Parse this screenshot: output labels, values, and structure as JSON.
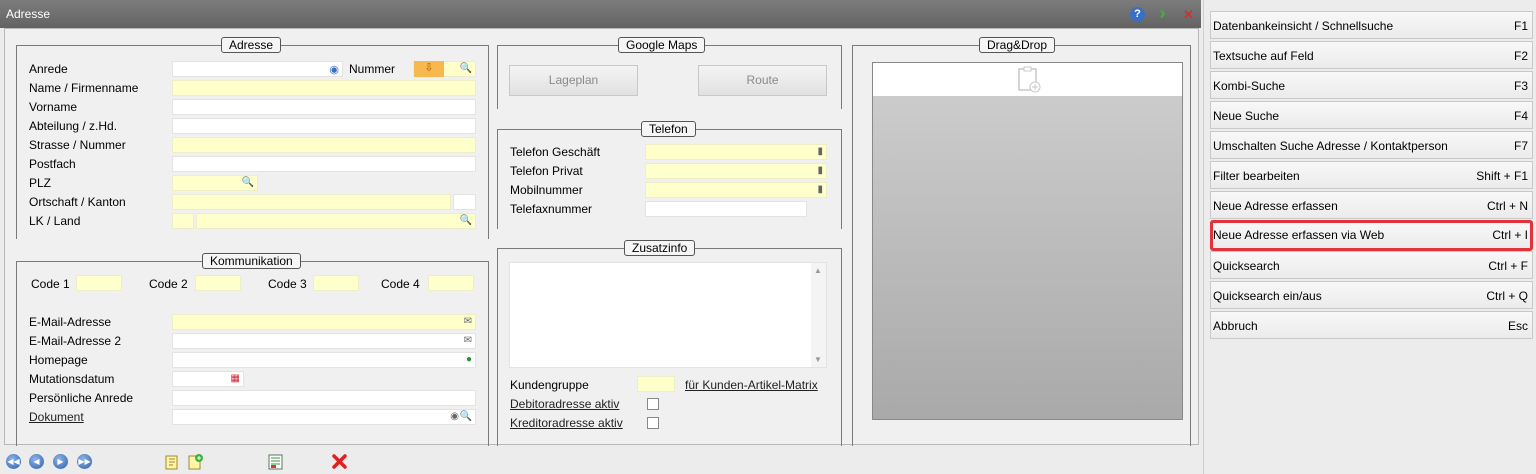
{
  "window": {
    "title": "Adresse",
    "help": "?",
    "next": "›",
    "close": "✕"
  },
  "adresse": {
    "legend": "Adresse",
    "anrede": "Anrede",
    "nummer": "Nummer",
    "name": "Name / Firmenname",
    "vorname": "Vorname",
    "abteilung": "Abteilung / z.Hd.",
    "strasse": "Strasse / Nummer",
    "postfach": "Postfach",
    "plz": "PLZ",
    "ortschaft": "Ortschaft / Kanton",
    "lk": "LK / Land"
  },
  "google": {
    "legend": "Google Maps",
    "lageplan": "Lageplan",
    "route": "Route"
  },
  "telefon": {
    "legend": "Telefon",
    "geschaeft": "Telefon Geschäft",
    "privat": "Telefon Privat",
    "mobil": "Mobilnummer",
    "fax": "Telefaxnummer"
  },
  "dragdrop": {
    "legend": "Drag&Drop"
  },
  "kommunikation": {
    "legend": "Kommunikation",
    "code1": "Code 1",
    "code2": "Code 2",
    "code3": "Code 3",
    "code4": "Code 4",
    "email": "E-Mail-Adresse",
    "email2": "E-Mail-Adresse 2",
    "homepage": "Homepage",
    "mutation": "Mutationsdatum",
    "anrede": "Persönliche Anrede",
    "dokument": "Dokument"
  },
  "zusatz": {
    "legend": "Zusatzinfo",
    "kundengruppe": "Kundengruppe",
    "matrix": "für Kunden-Artikel-Matrix",
    "debitor": "Debitoradresse aktiv",
    "kreditor": "Kreditoradresse aktiv"
  },
  "sidebar": {
    "items": [
      {
        "label": "Datenbankeinsicht / Schnellsuche",
        "key": "F1"
      },
      {
        "label": "Textsuche auf Feld",
        "key": "F2"
      },
      {
        "label": "Kombi-Suche",
        "key": "F3"
      },
      {
        "label": "Neue Suche",
        "key": "F4"
      },
      {
        "label": "Umschalten Suche Adresse / Kontaktperson",
        "key": "F7"
      },
      {
        "label": "Filter bearbeiten",
        "key": "Shift + F1"
      },
      {
        "label": "Neue Adresse erfassen",
        "key": "Ctrl + N"
      },
      {
        "label": "Neue Adresse erfassen via Web",
        "key": "Ctrl + I"
      },
      {
        "label": "Quicksearch",
        "key": "Ctrl + F"
      },
      {
        "label": "Quicksearch ein/aus",
        "key": "Ctrl + Q"
      },
      {
        "label": "Abbruch",
        "key": "Esc"
      }
    ]
  },
  "colors": {
    "field_yellow": "#ffffcc",
    "highlight_border": "#e2333b",
    "titlebar": "#6e6e6e"
  }
}
